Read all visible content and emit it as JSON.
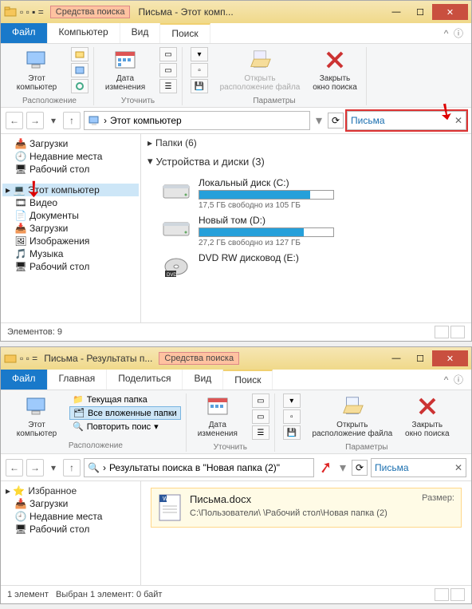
{
  "win1": {
    "tools_tab": "Средства поиска",
    "title": "Письма - Этот комп...",
    "menu": {
      "file": "Файл",
      "computer": "Компьютер",
      "view": "Вид",
      "search": "Поиск"
    },
    "ribbon": {
      "this_pc": "Этот\nкомпьютер",
      "date": "Дата\nизменения",
      "open_loc": "Открыть\nрасположение файла",
      "close_search": "Закрыть\nокно поиска",
      "grp_location": "Расположение",
      "grp_refine": "Уточнить",
      "grp_params": "Параметры"
    },
    "addr": {
      "crumb1": "Этот компьютер"
    },
    "search": {
      "value": "Письма"
    },
    "tree": {
      "downloads": "Загрузки",
      "recent": "Недавние места",
      "desktop": "Рабочий стол",
      "this_pc": "Этот компьютер",
      "video": "Видео",
      "documents": "Документы",
      "downloads2": "Загрузки",
      "pictures": "Изображения",
      "music": "Музыка",
      "desktop2": "Рабочий стол"
    },
    "content": {
      "folders_hdr": "Папки (6)",
      "devices_hdr": "Устройства и диски (3)",
      "drives": [
        {
          "name": "Локальный диск (C:)",
          "free": "17,5 ГБ свободно из 105 ГБ",
          "fill": 83
        },
        {
          "name": "Новый том (D:)",
          "free": "27,2 ГБ свободно из 127 ГБ",
          "fill": 78
        },
        {
          "name": "DVD RW дисковод (E:)",
          "free": "",
          "fill": 0
        }
      ]
    },
    "status": "Элементов: 9"
  },
  "win2": {
    "title": "Письма - Результаты п...",
    "tools_tab": "Средства поиска",
    "menu": {
      "file": "Файл",
      "home": "Главная",
      "share": "Поделиться",
      "view": "Вид",
      "search": "Поиск"
    },
    "ribbon": {
      "this_pc": "Этот\nкомпьютер",
      "cur_folder": "Текущая папка",
      "all_sub": "Все вложенные папки",
      "repeat": "Повторить поис",
      "date": "Дата\nизменения",
      "open_loc": "Открыть\nрасположение файла",
      "close_search": "Закрыть\nокно поиска",
      "grp_location": "Расположение",
      "grp_refine": "Уточнить",
      "grp_params": "Параметры"
    },
    "addr": {
      "text": "Результаты поиска в \"Новая папка (2)\""
    },
    "search": {
      "value": "Письма"
    },
    "tree": {
      "fav": "Избранное",
      "downloads": "Загрузки",
      "recent": "Недавние места",
      "desktop": "Рабочий стол"
    },
    "result": {
      "title": "Письма.docx",
      "size_label": "Размер:",
      "path": "C:\\Пользователи\\               \\Рабочий стол\\Новая папка (2)"
    },
    "status": {
      "items": "1 элемент",
      "sel": "Выбран 1 элемент: 0 байт"
    }
  }
}
